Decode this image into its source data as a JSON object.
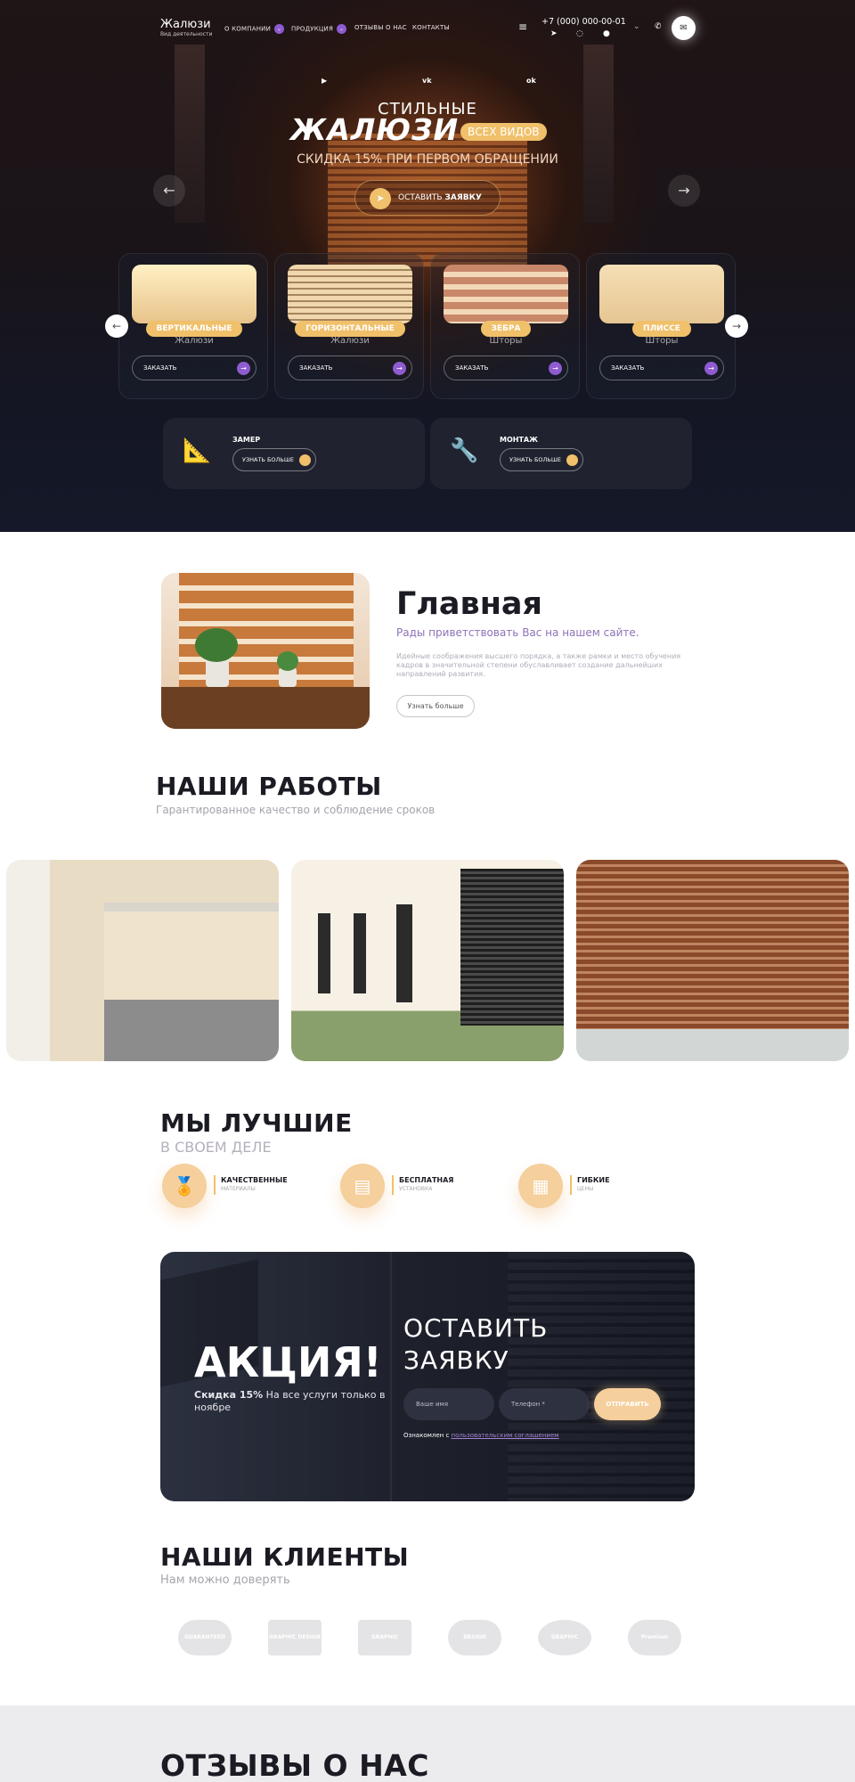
{
  "header": {
    "logo": "Жалюзи",
    "logo_sub": "Вид деятельности",
    "nav": [
      "О КОМПАНИИ",
      "ПРОДУКЦИЯ",
      "ОТЗЫВЫ О НАС",
      "КОНТАКТЫ"
    ],
    "phone": "+7 (000) 000-00-01"
  },
  "social": [
    "youtube-icon",
    "vk-icon",
    "odnoklassniki-icon"
  ],
  "hero": {
    "line1": "СТИЛЬНЫЕ",
    "line2": "ЖАЛЮЗИ",
    "badge": "ВСЕХ ВИДОВ",
    "line3": "СКИДКА 15% ПРИ ПЕРВОМ ОБРАЩЕНИИ",
    "cta_a": "ОСТАВИТЬ ",
    "cta_b": "ЗАЯВКУ"
  },
  "products": [
    {
      "title": "ВЕРТИКАЛЬНЫЕ",
      "sub": "Жалюзи",
      "btn": "ЗАКАЗАТЬ"
    },
    {
      "title": "ГОРИЗОНТАЛЬНЫЕ",
      "sub": "Жалюзи",
      "btn": "ЗАКАЗАТЬ"
    },
    {
      "title": "ЗЕБРА",
      "sub": "Шторы",
      "btn": "ЗАКАЗАТЬ"
    },
    {
      "title": "ПЛИССЕ",
      "sub": "Шторы",
      "btn": "ЗАКАЗАТЬ"
    }
  ],
  "services": [
    {
      "title": "ЗАМЕР",
      "btn": "УЗНАТЬ БОЛЬШЕ"
    },
    {
      "title": "МОНТАЖ",
      "btn": "УЗНАТЬ БОЛЬШЕ"
    }
  ],
  "about": {
    "title": "Главная",
    "subtitle": "Рады приветствовать Вас на нашем сайте.",
    "text": "Идейные соображения высшего порядка, а также рамки и место обучения кадров в значительной степени обуславливает создание дальнейших направлений развития.",
    "btn": "Узнать больше"
  },
  "works": {
    "title": "НАШИ РАБОТЫ",
    "subtitle": "Гарантированное качество и соблюдение сроков"
  },
  "best": {
    "title": "МЫ ЛУЧШИЕ",
    "subtitle": "В СВОЕМ ДЕЛЕ",
    "items": [
      {
        "t1": "КАЧЕСТВЕННЫЕ",
        "t2": "МАТЕРИАЛЫ"
      },
      {
        "t1": "БЕСПЛАТНАЯ",
        "t2": "УСТАНОВКА"
      },
      {
        "t1": "ГИБКИЕ",
        "t2": "ЦЕНЫ"
      }
    ]
  },
  "promo": {
    "title": "АКЦИЯ!",
    "sub_bold": "Скидка 15%",
    "sub_rest": " На все услуги только в ноябре",
    "form_title_1": "ОСТАВИТЬ",
    "form_title_2": "ЗАЯВКУ",
    "name_ph": "Ваше имя",
    "phone_ph": "Телефон *",
    "send": "ОТПРАВИТЬ",
    "agree": "Ознакомлен с ",
    "agree_link": "пользовательским соглашением"
  },
  "clients": {
    "title": "НАШИ КЛИЕНТЫ",
    "subtitle": "Нам можно доверять",
    "logos": [
      "GUARANTEED",
      "GRAPHIC DESIGN",
      "GRAPHIC",
      "DESIGN",
      "GRAPHIC",
      "Premium"
    ]
  },
  "reviews": {
    "title": "ОТЗЫВЫ О НАС"
  },
  "colors": {
    "accent": "#f0c06a",
    "purple": "#8e5bd0",
    "dark": "#1b1b24"
  }
}
